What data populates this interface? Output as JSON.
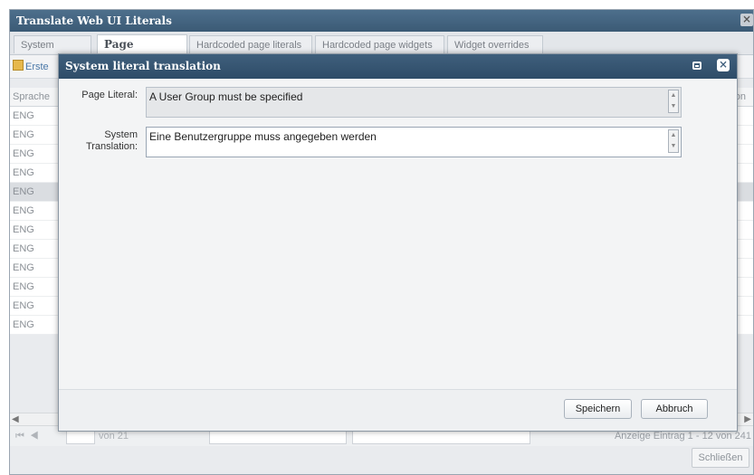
{
  "window": {
    "title": "Translate Web UI Literals",
    "close_glyph": "×"
  },
  "tabs": [
    {
      "label": "System literals"
    },
    {
      "label": "Page literals",
      "active": true
    },
    {
      "label": "Hardcoded page literals"
    },
    {
      "label": "Hardcoded page widgets"
    },
    {
      "label": "Widget overrides"
    }
  ],
  "toolbar": {
    "create_label": "Erste"
  },
  "grid": {
    "headers": {
      "language": "Sprache",
      "translation_partial": "ation"
    },
    "rows": [
      "ENG",
      "ENG",
      "ENG",
      "ENG",
      "ENG",
      "ENG",
      "ENG",
      "ENG",
      "ENG",
      "ENG",
      "ENG",
      "ENG"
    ],
    "selected_row_index": 4,
    "pager": {
      "of_text": "von 21",
      "status": "Anzeige Eintrag 1 - 12 von 241"
    }
  },
  "footer": {
    "close_label": "Schließen"
  },
  "modal": {
    "title": "System literal translation",
    "page_literal_label": "Page Literal:",
    "page_literal_value": "A User Group must be specified",
    "translation_label_line1": "System",
    "translation_label_line2": "Translation:",
    "translation_value": "Eine Benutzergruppe muss angegeben werden",
    "save_label": "Speichern",
    "cancel_label": "Abbruch"
  }
}
